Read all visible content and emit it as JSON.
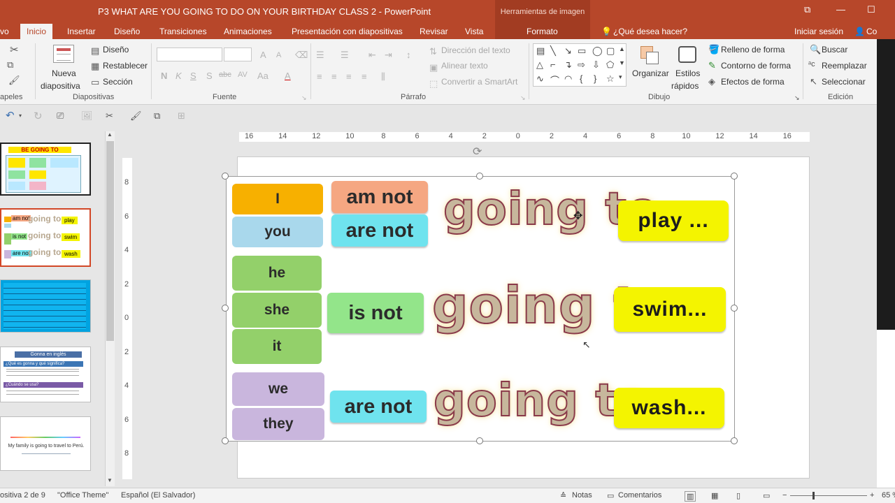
{
  "window": {
    "title": "P3 WHAT ARE YOU GOING TO DO ON YOUR BIRTHDAY CLASS 2 - PowerPoint",
    "contextual_tab_group": "Herramientas de imagen"
  },
  "tabs": [
    {
      "label": "vo",
      "active": false
    },
    {
      "label": "Inicio",
      "active": true
    },
    {
      "label": "Insertar",
      "active": false
    },
    {
      "label": "Diseño",
      "active": false
    },
    {
      "label": "Transiciones",
      "active": false
    },
    {
      "label": "Animaciones",
      "active": false
    },
    {
      "label": "Presentación con diapositivas",
      "active": false
    },
    {
      "label": "Revisar",
      "active": false
    },
    {
      "label": "Vista",
      "active": false
    },
    {
      "label": "Formato",
      "active": false
    }
  ],
  "tell_me": "¿Qué desea hacer?",
  "signin": "Iniciar sesión",
  "share": "Co",
  "ribbon": {
    "groups": {
      "clipboard": "apeles",
      "slides": "Diapositivas",
      "font": "Fuente",
      "paragraph": "Párrafo",
      "drawing": "Dibujo",
      "editing": "Edición"
    },
    "slides": {
      "new_slide_1": "Nueva",
      "new_slide_2": "diapositiva",
      "layout": "Diseño",
      "reset": "Restablecer",
      "section": "Sección"
    },
    "font": {
      "bold": "N",
      "italic": "K",
      "underline": "S",
      "shadow": "S",
      "strike": "abc",
      "spacing": "AV",
      "case": "Aa",
      "color": "A",
      "grow": "A",
      "shrink": "A"
    },
    "paragraph": {
      "text_direction": "Dirección del texto",
      "align_text": "Alinear texto",
      "smartart": "Convertir a SmartArt"
    },
    "drawing": {
      "arrange": "Organizar",
      "quick_styles_1": "Estilos",
      "quick_styles_2": "rápidos",
      "fill": "Relleno de forma",
      "outline": "Contorno de forma",
      "effects": "Efectos de forma"
    },
    "editing": {
      "find": "Buscar",
      "replace": "Reemplazar",
      "select": "Seleccionar"
    }
  },
  "ruler": {
    "horizontal": [
      "16",
      "14",
      "12",
      "10",
      "8",
      "6",
      "4",
      "2",
      "0",
      "2",
      "4",
      "6",
      "8",
      "10",
      "12",
      "14",
      "16"
    ],
    "vertical": [
      "8",
      "6",
      "4",
      "2",
      "0",
      "2",
      "4",
      "6",
      "8"
    ]
  },
  "thumbs": {
    "t1_title": "BE GOING TO",
    "t2": [
      "am not",
      "going to",
      "play",
      "is not",
      "going to",
      "swim",
      "are not",
      "going to",
      "wash"
    ],
    "t4_title": "Gonna en inglés",
    "t4_q1": "¿Qué es gonna y qué significa?",
    "t4_q2": "¿Cuándo se usa?",
    "t5_text": "My family is going to travel to Perú."
  },
  "slide": {
    "subjects": [
      "I",
      "you",
      "he",
      "she",
      "it",
      "we",
      "they"
    ],
    "negations": [
      "am not",
      "are not",
      "is not",
      "are not"
    ],
    "going_to": "going to",
    "verbs": [
      "play ...",
      "swim...",
      "wash..."
    ],
    "colors": {
      "i": "#f7b000",
      "you": "#a9d8ec",
      "he_she_it": "#93d06a",
      "we_they": "#c9b6dd",
      "neg_am": "#f5a782",
      "neg_is": "#93e58a",
      "neg_are": "#6fe3ee",
      "verb": "#f4f400"
    }
  },
  "status": {
    "slide_info": "ositiva 2 de 9",
    "theme": "\"Office Theme\"",
    "language": "Español (El Salvador)",
    "notes": "Notas",
    "comments": "Comentarios",
    "zoom": "65 %"
  }
}
